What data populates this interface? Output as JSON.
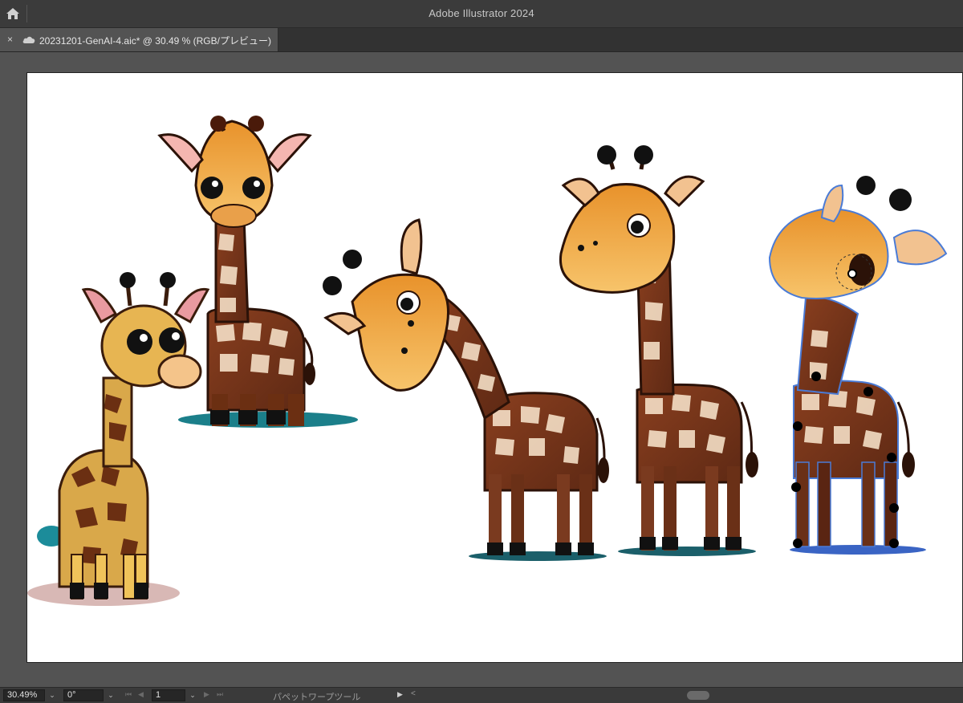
{
  "titlebar": {
    "app_title": "Adobe Illustrator 2024",
    "home_icon": "home-icon"
  },
  "tabs": [
    {
      "close_label": "×",
      "cloud_icon": "cloud-icon",
      "label": "20231201-GenAI-4.aic* @ 30.49 % (RGB/プレビュー)"
    }
  ],
  "statusbar": {
    "zoom": "30.49%",
    "rotation": "0°",
    "artboard_number": "1",
    "current_tool": "パペットワープツール",
    "play_icon": "▶",
    "collapse_icon": "<"
  },
  "artboard": {
    "background": "#ffffff"
  },
  "artwork_objects": [
    "giraffe-baby-front",
    "giraffe-cute-standing",
    "giraffe-bending-down",
    "giraffe-tall-standing",
    "giraffe-puppet-warp-selected"
  ],
  "colors": {
    "ui_dark": "#323232",
    "ui_mid": "#535353",
    "giraffe_orange": "#e9a23b",
    "giraffe_brown": "#7a3a1f",
    "spot_cream": "#f5e6c8",
    "shadow_teal": "#1b7f8a",
    "selection_blue": "#4a7bd6"
  }
}
